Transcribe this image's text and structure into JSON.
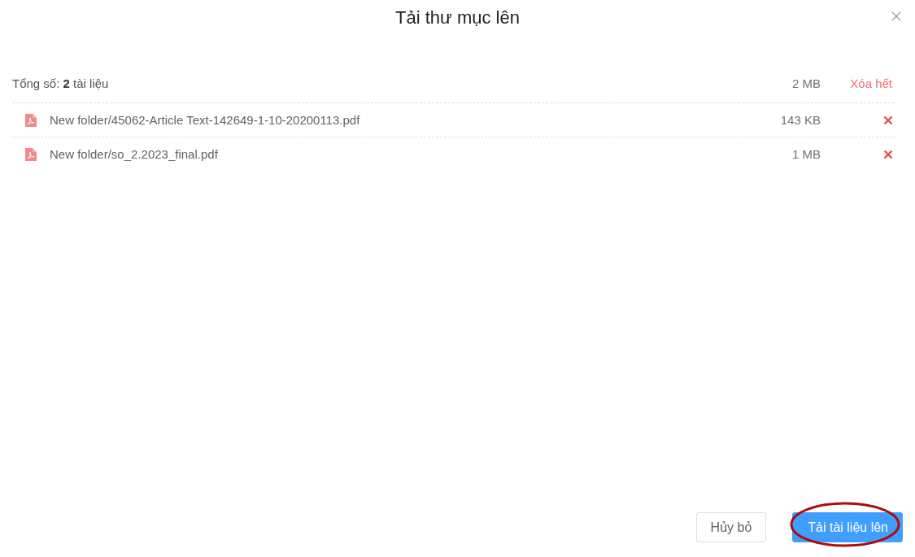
{
  "dialog": {
    "title": "Tải thư mục lên"
  },
  "summary": {
    "text": "Tổng số: **2** tài liệu",
    "total_size": "2 MB",
    "clear_all": "Xóa hết"
  },
  "files": [
    {
      "name": "New folder/45062-Article Text-142649-1-10-20200113.pdf",
      "size": "143 KB"
    },
    {
      "name": "New folder/so_2.2023_final.pdf",
      "size": "1 MB"
    }
  ],
  "buttons": [
    {
      "label": "Hủy bỏ",
      "kind": "secondary",
      "highlighted": false
    },
    {
      "label": "Tải tài liệu lên",
      "kind": "primary",
      "highlighted": true
    }
  ]
}
